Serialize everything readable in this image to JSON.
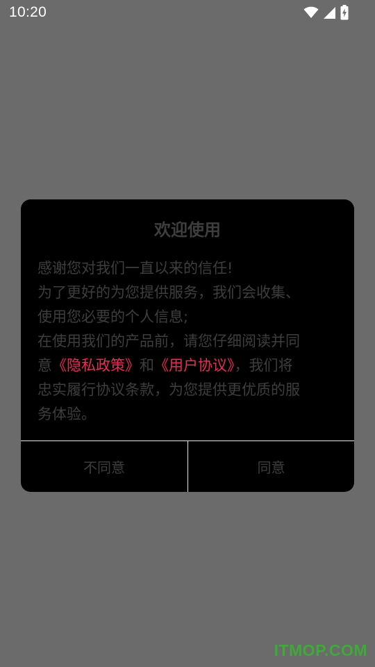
{
  "status_bar": {
    "time": "10:20",
    "icons": [
      "wifi-icon",
      "cellular-signal-icon",
      "battery-charging-icon"
    ]
  },
  "dialog": {
    "title": "欢迎使用",
    "lines": {
      "l1": "感谢您对我们一直以来的信任!",
      "l2": "为了更好的为您提供服务，我们会收集、",
      "l3": "使用您必要的个人信息;",
      "l4": "在使用我们的产品前，请您仔细阅读并同",
      "l5_prefix": "意",
      "privacy_link": "《隐私政策》",
      "l5_and": "和",
      "user_agreement_link": "《用户协议》",
      "l5_suffix": "，我们将",
      "l6": "忠实履行协议条款，为您提供更优质的服",
      "l7": "务体验。"
    },
    "disagree_label": "不同意",
    "agree_label": "同意"
  },
  "watermark": "ITMOP.COM",
  "colors": {
    "backdrop": "#6b6b6b",
    "dialog_bg": "#000000",
    "text": "#3e3e3e",
    "link": "#ef2b55",
    "watermark": "#3fa93a"
  }
}
